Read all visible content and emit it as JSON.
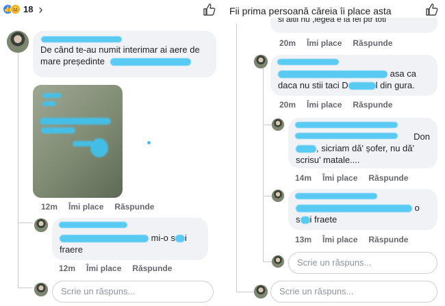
{
  "left": {
    "reaction_count": "18",
    "comment_main": {
      "text_line1": "De când te-au numit interimar ai aere de",
      "text_line2": "mare președinte",
      "time": "12m",
      "like": "Îmi place",
      "reply": "Răspunde"
    },
    "reply_1": {
      "text_mid": "mi-o s",
      "text_end": "i",
      "text_line2": "fraere",
      "time": "12m",
      "like": "Îmi place",
      "reply": "Răspunde"
    },
    "reply_box_placeholder": "Scrie un răspuns..."
  },
  "right": {
    "header": "Fii prima persoană căreia îi place asta",
    "top_partial": {
      "text": "si altii nu ,legea e la fel ptr toti",
      "time": "20m",
      "like": "Îmi place",
      "reply": "Răspunde"
    },
    "comment_2": {
      "text_a": "asa ca",
      "text_b": "daca nu stii taci D",
      "text_c": "l din gura.",
      "time": "20m",
      "like": "Îmi place",
      "reply": "Răspunde"
    },
    "comment_3": {
      "text_a": "Don",
      "text_b": ", sicriam dă' șofer, nu dă'",
      "text_c": "scrisu' matale....",
      "time": "14m",
      "like": "Îmi place",
      "reply": "Răspunde"
    },
    "comment_4": {
      "text_a": "o",
      "text_b": "s",
      "text_c": "i fraete",
      "time": "13m",
      "like": "Îmi place",
      "reply": "Răspunde"
    },
    "reply_box_placeholder": "Scrie un răspuns..."
  },
  "icons": {
    "like_reaction": "like-reaction-icon",
    "haha_reaction": "haha-reaction-icon",
    "chevron": "chevron-right-icon",
    "thumb_up": "thumbs-up-outline-icon"
  },
  "colors": {
    "bubble": "#f0f2f5",
    "meta_text": "#65676b",
    "like_blue": "#2d88ff",
    "redaction": "#3fc4f2"
  }
}
